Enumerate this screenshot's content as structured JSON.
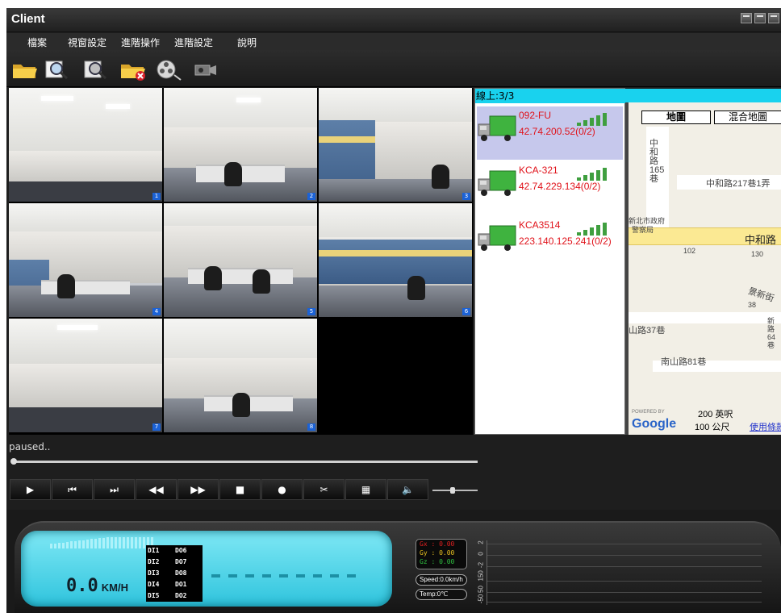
{
  "window": {
    "title": "Client"
  },
  "menu": [
    {
      "label": "檔案"
    },
    {
      "label": "視窗設定"
    },
    {
      "label": "進階操作"
    },
    {
      "label": "進階設定"
    },
    {
      "label": "說明"
    }
  ],
  "toolbar": [
    {
      "icon": "open-folder-icon"
    },
    {
      "icon": "search-icon"
    },
    {
      "icon": "search-settings-icon"
    },
    {
      "icon": "delete-folder-icon"
    },
    {
      "icon": "film-reel-icon"
    },
    {
      "icon": "camera-icon"
    }
  ],
  "cameras": [
    {
      "channel": "1"
    },
    {
      "channel": "2"
    },
    {
      "channel": "3"
    },
    {
      "channel": "4"
    },
    {
      "channel": "5"
    },
    {
      "channel": "6"
    },
    {
      "channel": "7"
    },
    {
      "channel": "8"
    }
  ],
  "vehicles": {
    "online_label": "線上:3/3",
    "items": [
      {
        "name": "092-FU",
        "ip": "42.74.200.52(0/2)",
        "selected": true
      },
      {
        "name": "KCA-321",
        "ip": "42.74.229.134(0/2)",
        "selected": false
      },
      {
        "name": "KCA3514",
        "ip": "223.140.125.241(0/2)",
        "selected": false
      }
    ]
  },
  "map": {
    "map_button": "地圖",
    "hybrid_button": "混合地圖",
    "labels": {
      "zhonghe_alley": "中和路217巷1弄",
      "zhonghe_road": "中和路",
      "zhonghe_lane": "中和路165巷",
      "govt": "新北市政府",
      "police": "警察局",
      "no_102": "102",
      "no_130": "130",
      "jingxin": "景新街",
      "no_38": "38",
      "shan_37": "山路37巷",
      "nanshan_81": "南山路81巷",
      "xinglu": "新路64巷",
      "scale_ft": "200 英呎",
      "scale_m": "100 公尺",
      "terms": "使用條款",
      "powered": "POWERED BY",
      "google": "Google"
    }
  },
  "playback": {
    "status": "paused..",
    "progress": 0,
    "volume": 0.45,
    "buttons": [
      {
        "name": "play-button",
        "icon": "play-icon",
        "glyph": "▶"
      },
      {
        "name": "prev-frame-button",
        "icon": "skip-back-icon",
        "glyph": "⏮"
      },
      {
        "name": "next-frame-button",
        "icon": "skip-forward-icon",
        "glyph": "⏭"
      },
      {
        "name": "rewind-button",
        "icon": "rewind-icon",
        "glyph": "◀◀"
      },
      {
        "name": "fast-forward-button",
        "icon": "fast-forward-icon",
        "glyph": "▶▶"
      },
      {
        "name": "stop-button",
        "icon": "stop-icon",
        "glyph": "■"
      },
      {
        "name": "record-button",
        "icon": "record-icon",
        "glyph": "●"
      },
      {
        "name": "snapshot-button",
        "icon": "scissors-icon",
        "glyph": "✂"
      },
      {
        "name": "layout-button",
        "icon": "grid-icon",
        "glyph": "▦"
      },
      {
        "name": "mute-button",
        "icon": "speaker-icon",
        "glyph": "🔈"
      }
    ]
  },
  "dashboard": {
    "speed_value": "0.0",
    "speed_unit": "KM/H",
    "io": [
      "DI1",
      "DI2",
      "DI3",
      "DI4",
      "DI5",
      "DO6",
      "DO7",
      "DO8",
      "DO1",
      "DO2"
    ],
    "gx": "Gx : 0.00",
    "gy": "Gy : 0.00",
    "gz": "Gz : 0.00",
    "speed_pill": "Speed:0.0km/h",
    "temp_pill": "Temp:0℃",
    "chart_ticks": [
      "2",
      "0",
      "-2",
      "150",
      "50",
      "-50"
    ],
    "colors": {
      "gx": "#e02020",
      "gy": "#e8c020",
      "gz": "#30c040"
    }
  }
}
